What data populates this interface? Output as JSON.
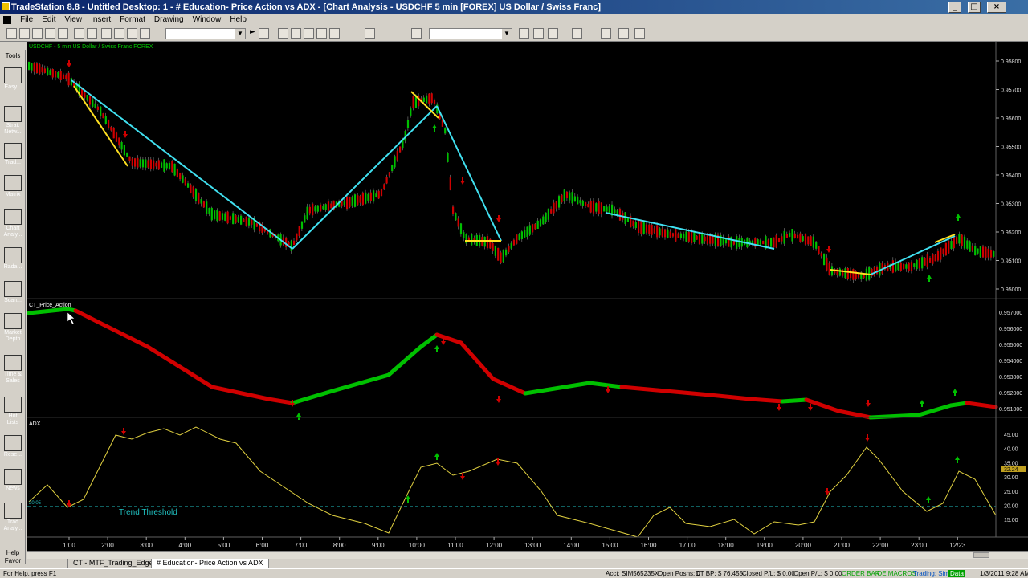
{
  "window": {
    "title": "TradeStation 8.8 - Untitled Desktop: 1 - # Education- Price Action vs ADX - [Chart Analysis - USDCHF 5 min [FOREX] US Dollar / Swiss Franc]",
    "controls": [
      "_",
      "□",
      "×"
    ]
  },
  "menu": [
    "File",
    "Edit",
    "View",
    "Insert",
    "Format",
    "Drawing",
    "Window",
    "Help"
  ],
  "shortcut_bar": {
    "header": "Tools",
    "footer": [
      "Help",
      "Favor"
    ],
    "items": [
      {
        "label": "Easy...",
        "color": "#3a7a3a"
      },
      {
        "label": "Strat. Netw...",
        "color": "#2a5a9a"
      },
      {
        "label": "Trad...",
        "color": "#c03030"
      },
      {
        "label": "Matrix",
        "color": "#2060a0"
      },
      {
        "label": "Chart Analy...",
        "color": "#204080"
      },
      {
        "label": "Rada...",
        "color": "#2a6aa0"
      },
      {
        "label": "Scan...",
        "color": "#305070"
      },
      {
        "label": "Market Depth",
        "color": "#40a040"
      },
      {
        "label": "Time & Sales",
        "color": "#c0a020"
      },
      {
        "label": "Hot Lists",
        "color": "#303030"
      },
      {
        "label": "Rese...",
        "color": "#20a040"
      },
      {
        "label": "News",
        "color": "#d0d0d0"
      },
      {
        "label": "Trad Analy...",
        "color": "#3a6a9a"
      }
    ]
  },
  "chart": {
    "symbol_label": "USDCHF - 5 min  US Dollar / Swiss Franc  FOREX",
    "indicator1_label": "CT_Price_Action",
    "indicator2_label": "ADX",
    "threshold_label": "Trend Threshold",
    "threshold_value": "20.05",
    "price_axis": [
      "0.95800",
      "0.95700",
      "0.95600",
      "0.95500",
      "0.95400",
      "0.95300",
      "0.95200",
      "0.95100",
      "0.95000"
    ],
    "ind1_axis": [
      "0.957000",
      "0.956000",
      "0.955000",
      "0.954000",
      "0.953000",
      "0.952000",
      "0.951000"
    ],
    "adx_axis": [
      "45.00",
      "40.00",
      "35.00",
      "30.00",
      "25.00",
      "20.00",
      "15.00"
    ],
    "adx_last": "32.24",
    "time_axis": [
      "1:00",
      "2:00",
      "3:00",
      "4:00",
      "5:00",
      "6:00",
      "7:00",
      "8:00",
      "9:00",
      "10:00",
      "11:00",
      "12:00",
      "13:00",
      "14:00",
      "15:00",
      "16:00",
      "17:00",
      "18:00",
      "19:00",
      "20:00",
      "21:00",
      "22:00",
      "23:00",
      "12/23"
    ],
    "colors": {
      "up": "#00c000",
      "down": "#d00000",
      "trend_line": "#40e0f0",
      "swing_line": "#ffe020",
      "adx": "#e0d040",
      "threshold": "#20c0c0"
    }
  },
  "tabs": [
    "CT - MTF_Trading_Edge",
    "# Education- Price Action vs ADX"
  ],
  "status": {
    "help": "For Help, press F1",
    "account": "Acct: SIM565235X",
    "open_posns": "Open Posns: 0",
    "dt_bp": "DT BP: $ 76,455",
    "closed_pl": "Closed P/L: $ 0.00",
    "open_pl": "Open P/L: $ 0.00",
    "order_bar": "ORDER BAR",
    "oe_macros": "OE MACROS",
    "trading": "Trading: Sim",
    "data": "Data",
    "datetime": "1/3/2011  9:28 AM"
  }
}
